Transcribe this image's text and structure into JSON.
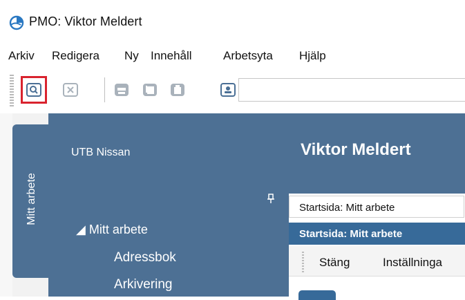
{
  "window": {
    "title": "PMO: Viktor Meldert",
    "icon": "pmo-app-icon"
  },
  "menu": [
    "Arkiv",
    "Redigera",
    "Ny",
    "Innehåll",
    "Arbetsyta",
    "Hjälp"
  ],
  "toolbar": {
    "buttons": [
      "search-icon",
      "close-icon",
      "print-icon",
      "copy-icon",
      "clipboard-icon",
      "contact-card-icon"
    ],
    "highlighted": "search-icon",
    "highlight_color": "#d9232e"
  },
  "sidebar": {
    "tab_label": "Mitt arbete",
    "org": "UTB Nissan",
    "tree_root": "◢ Mitt arbete",
    "tree_items": [
      "Adressbok",
      "Arkivering"
    ]
  },
  "main": {
    "heading": "Viktor Meldert",
    "tabs": [
      "Startsida: Mitt arbete",
      "Startsida: Mitt arbete"
    ],
    "actions": [
      "Stäng",
      "Inställninga"
    ]
  },
  "colors": {
    "panel": "#4d7094",
    "tab_active": "#376a99"
  }
}
